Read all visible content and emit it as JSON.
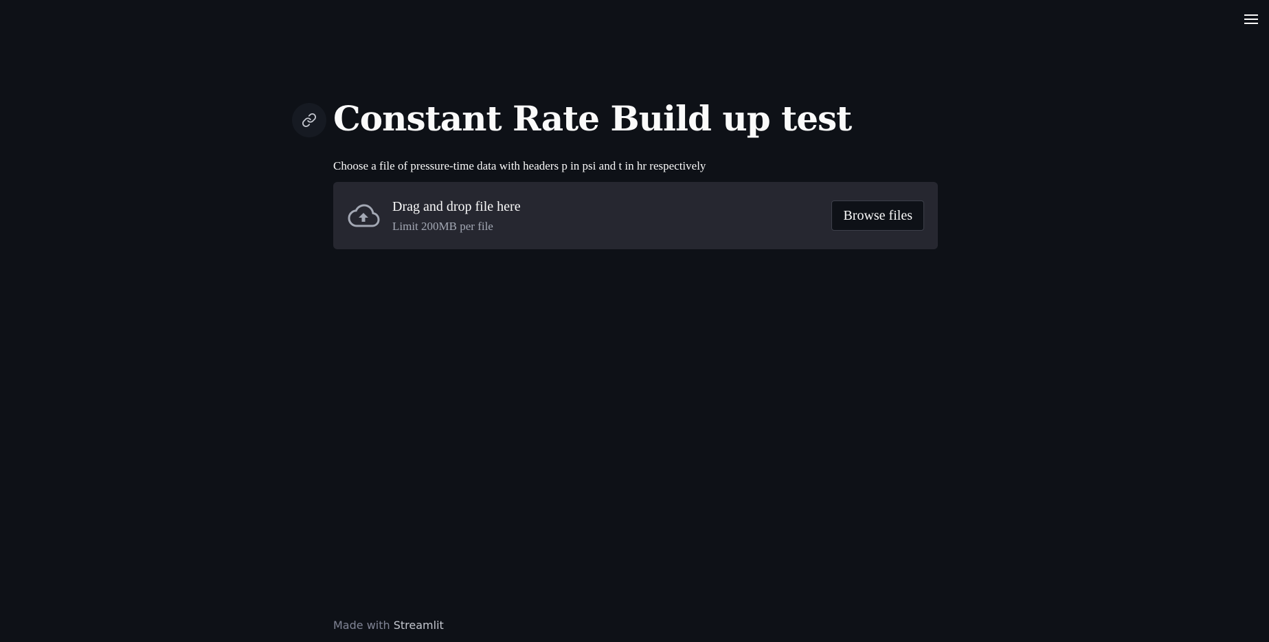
{
  "header": {
    "menu_icon": "hamburger-menu-icon"
  },
  "main": {
    "title": "Constant Rate Build up test",
    "anchor_icon": "link-icon",
    "uploader": {
      "label": "Choose a file of pressure-time data with headers p in psi and t in hr respectively",
      "icon": "cloud-upload-icon",
      "primary_text": "Drag and drop file here",
      "secondary_text": "Limit 200MB per file",
      "button_label": "Browse files"
    }
  },
  "footer": {
    "made_with": "Made with",
    "brand": "Streamlit"
  },
  "colors": {
    "background": "#0e1117",
    "dropzone": "#262730",
    "text": "#fafafa",
    "muted": "#a3a8b4"
  }
}
